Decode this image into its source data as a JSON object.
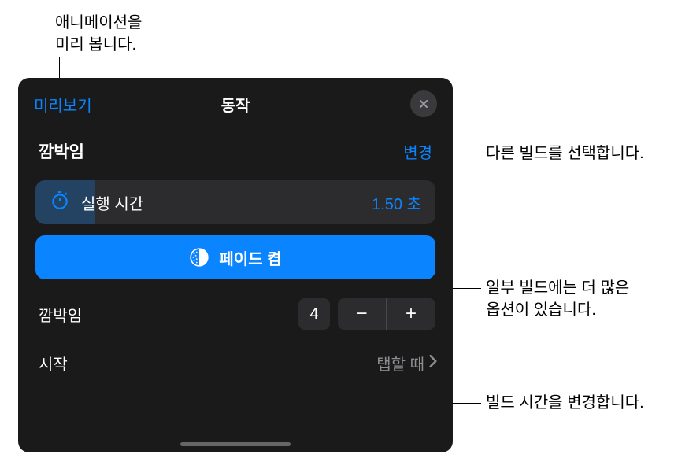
{
  "callouts": {
    "preview": "애니메이션을\n미리 봅니다.",
    "change": "다른 빌드를 선택합니다.",
    "options": "일부 빌드에는 더 많은\n옵션이 있습니다.",
    "timing": "빌드 시간을 변경합니다."
  },
  "header": {
    "preview": "미리보기",
    "title": "동작"
  },
  "section": {
    "title": "깜박임",
    "change": "변경"
  },
  "duration": {
    "label": "실행 시간",
    "value": "1.50 초"
  },
  "fade": {
    "label": "페이드 켬"
  },
  "stepper": {
    "label": "깜박임",
    "value": "4",
    "minus": "−",
    "plus": "+"
  },
  "start": {
    "label": "시작",
    "value": "탭할 때"
  }
}
